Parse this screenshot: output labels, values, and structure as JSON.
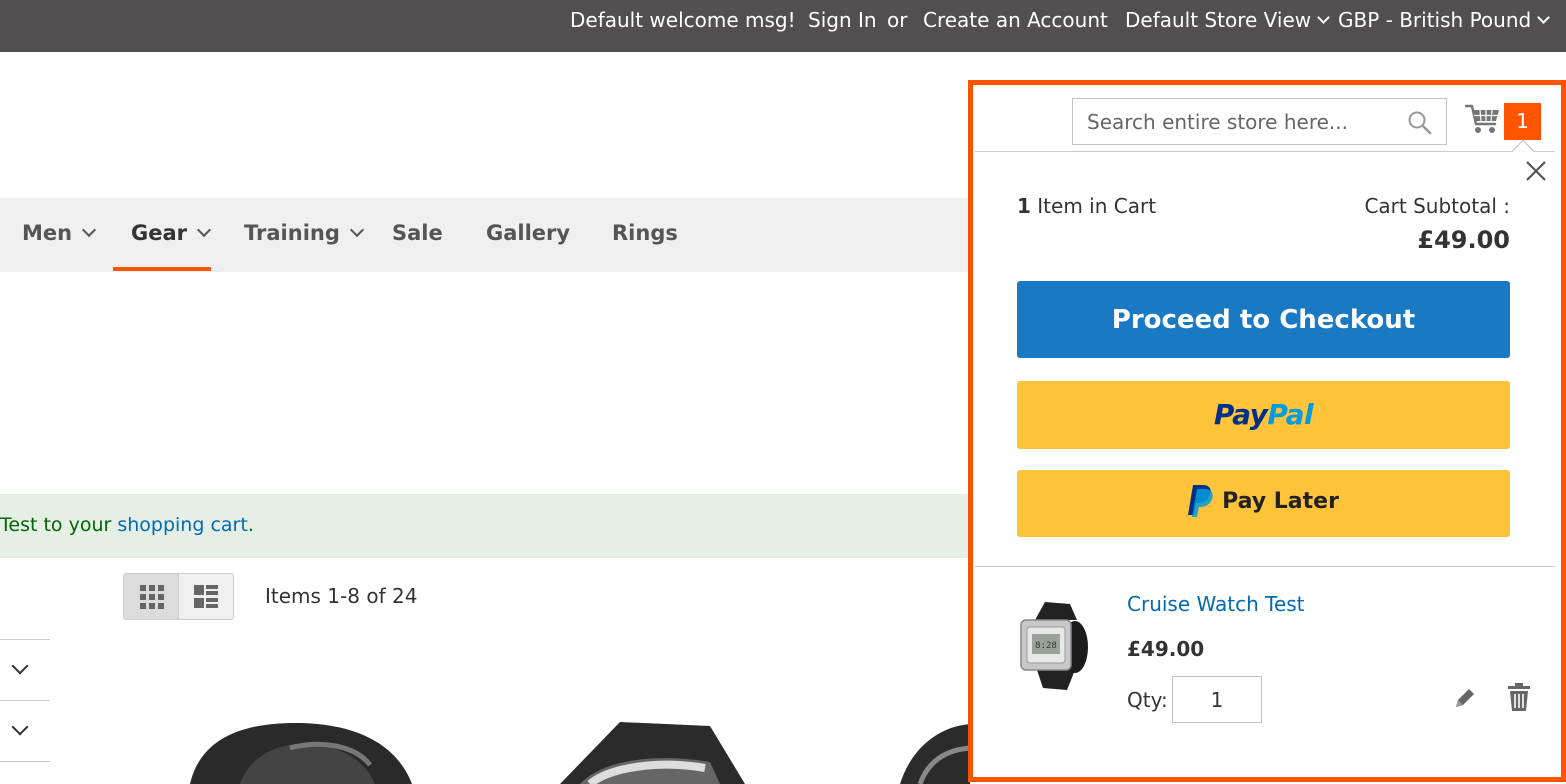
{
  "header": {
    "welcome": "Default welcome msg!",
    "sign_in": "Sign In",
    "or": "or",
    "create_account": "Create an Account",
    "store_view": "Default Store View",
    "currency": "GBP - British Pound"
  },
  "nav": {
    "items": [
      {
        "label": "Men",
        "has_submenu": true
      },
      {
        "label": "Gear",
        "has_submenu": true,
        "active": true
      },
      {
        "label": "Training",
        "has_submenu": true
      },
      {
        "label": "Sale",
        "has_submenu": false
      },
      {
        "label": "Gallery",
        "has_submenu": false
      },
      {
        "label": "Rings",
        "has_submenu": false
      }
    ]
  },
  "message": {
    "text_before": "Test to your ",
    "link": "shopping cart",
    "text_after": "."
  },
  "toolbar": {
    "modes": [
      "grid-icon",
      "list-icon"
    ],
    "amount": "Items 1-8 of 24"
  },
  "search": {
    "placeholder": "Search entire store here..."
  },
  "minicart": {
    "counter": "1",
    "items_count": "1",
    "items_label": " Item in Cart",
    "subtotal_label": "Cart Subtotal :",
    "subtotal_value": "£49.00",
    "checkout_label": "Proceed to Checkout",
    "paypal_pay": "Pay",
    "paypal_pal": "Pal",
    "paylater_label": "Pay Later",
    "item": {
      "name": "Cruise Watch Test",
      "price": "£49.00",
      "qty_label": "Qty:",
      "qty": "1"
    }
  },
  "colors": {
    "accent": "#ff5501",
    "checkout": "#1979c3",
    "paypal": "#ffc439",
    "link": "#006bb4",
    "topbar": "#514f4f"
  }
}
